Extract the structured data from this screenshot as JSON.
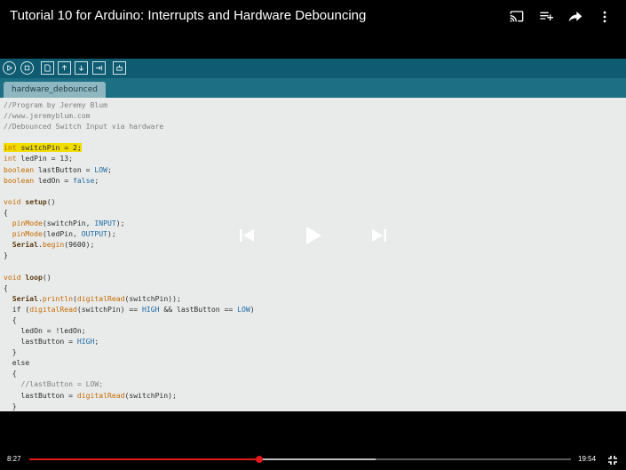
{
  "video": {
    "title": "Tutorial 10 for Arduino: Interrupts and Hardware Debouncing",
    "current_time": "8:27",
    "duration": "19:54",
    "progress_fraction": 0.425,
    "buffered_fraction": 0.64
  },
  "top_icons": [
    "cast-icon",
    "add-to-queue-icon",
    "share-icon",
    "more-vert-icon"
  ],
  "ide": {
    "tab_label": "hardware_debounced",
    "toolbar_icons": [
      "verify-icon",
      "stop-icon",
      "new-icon",
      "open-icon",
      "save-icon",
      "upload-icon",
      "serial-monitor-icon"
    ],
    "code_lines": [
      "//Program by Jeremy Blum",
      "//www.jeremyblum.com",
      "//Debounced Switch Input via hardware",
      "",
      "int switchPin = 2;",
      "int ledPin = 13;",
      "boolean lastButton = LOW;",
      "boolean ledOn = false;",
      "",
      "void setup()",
      "{",
      "  pinMode(switchPin, INPUT);",
      "  pinMode(ledPin, OUTPUT);",
      "  Serial.begin(9600);",
      "}",
      "",
      "void loop()",
      "{",
      "  Serial.println(digitalRead(switchPin));",
      "  if (digitalRead(switchPin) == HIGH && lastButton == LOW)",
      "  {",
      "    ledOn = !ledOn;",
      "    lastButton = HIGH;",
      "  }",
      "  else",
      "  {",
      "    //lastButton = LOW;",
      "    lastButton = digitalRead(switchPin);",
      "  }"
    ]
  },
  "player_controls": [
    "previous-icon",
    "play-icon",
    "next-icon",
    "exit-fullscreen-icon"
  ],
  "colors": {
    "progress": "#e21a1a",
    "ide_toolbar": "#0f5c72",
    "highlight": "#f1dd00"
  }
}
